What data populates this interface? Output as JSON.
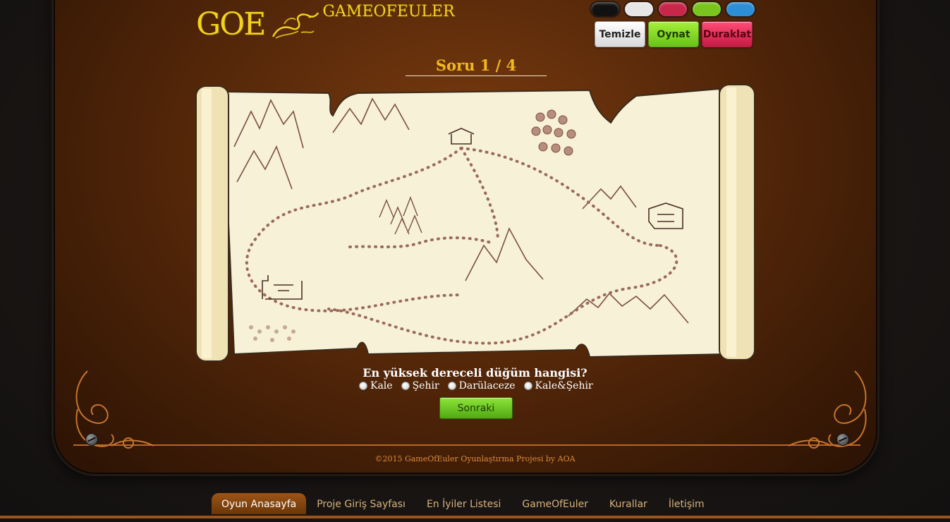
{
  "header": {
    "logo_short": "GOE",
    "logo_name": "GAMEOFEULER"
  },
  "colors": {
    "swatches": [
      "#111111",
      "#e6e6e6",
      "#c8274a",
      "#7ac41e",
      "#2c8ed4"
    ]
  },
  "controls": {
    "clear_label": "Temizle",
    "play_label": "Oynat",
    "pause_label": "Duraklat"
  },
  "question": {
    "counter": "Soru 1 / 4",
    "prompt": "En yüksek dereceli düğüm hangisi?",
    "options": [
      "Kale",
      "Şehir",
      "Darülaceze",
      "Kale&Şehir"
    ],
    "next_label": "Sonraki"
  },
  "footer": {
    "copyright": "©2015 GameOfEuler Oyunlaştırma Projesi by AOA"
  },
  "nav": {
    "items": [
      "Oyun Anasayfa",
      "Proje Giriş Sayfası",
      "En İyiler Listesi",
      "GameOfEuler",
      "Kurallar",
      "İletişim"
    ]
  }
}
